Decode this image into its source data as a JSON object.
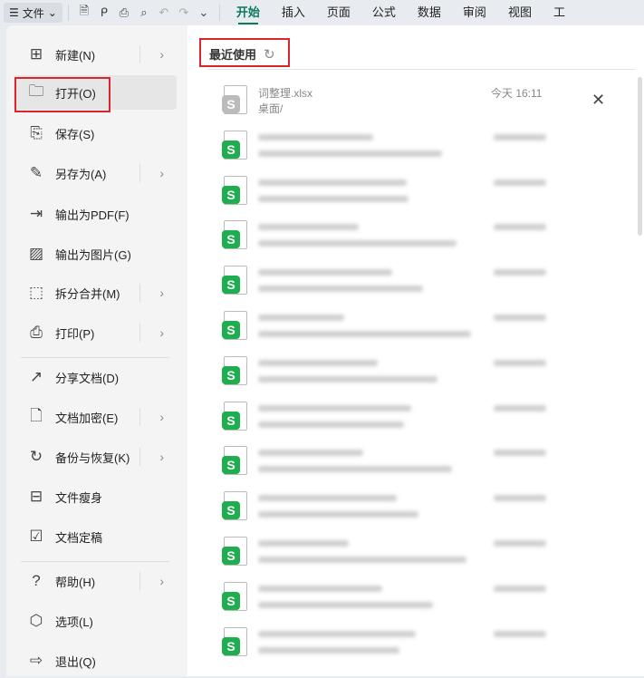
{
  "toolbar": {
    "file_label": "文件",
    "tabs": [
      "开始",
      "插入",
      "页面",
      "公式",
      "数据",
      "审阅",
      "视图",
      "工"
    ]
  },
  "menu": {
    "items": [
      {
        "label": "新建(N)",
        "icon": "new-file-icon",
        "glyph": "⊞",
        "sub": true
      },
      {
        "label": "打开(O)",
        "icon": "folder-open-icon",
        "glyph": "🗀",
        "sub": false
      },
      {
        "label": "保存(S)",
        "icon": "save-icon",
        "glyph": "⎘",
        "sub": false
      },
      {
        "label": "另存为(A)",
        "icon": "save-as-icon",
        "glyph": "✎",
        "sub": true
      },
      {
        "label": "输出为PDF(F)",
        "icon": "export-pdf-icon",
        "glyph": "⇥",
        "sub": false
      },
      {
        "label": "输出为图片(G)",
        "icon": "export-image-icon",
        "glyph": "▨",
        "sub": false
      },
      {
        "label": "拆分合并(M)",
        "icon": "split-merge-icon",
        "glyph": "⬚",
        "sub": true
      },
      {
        "label": "打印(P)",
        "icon": "print-icon",
        "glyph": "⎙",
        "sub": true
      },
      {
        "label": "分享文档(D)",
        "icon": "share-icon",
        "glyph": "↗",
        "sub": false
      },
      {
        "label": "文档加密(E)",
        "icon": "encrypt-icon",
        "glyph": "🗋",
        "sub": true
      },
      {
        "label": "备份与恢复(K)",
        "icon": "backup-icon",
        "glyph": "↻",
        "sub": true
      },
      {
        "label": "文件瘦身",
        "icon": "compress-icon",
        "glyph": "⊟",
        "sub": false
      },
      {
        "label": "文档定稿",
        "icon": "finalize-icon",
        "glyph": "☑",
        "sub": false
      },
      {
        "label": "帮助(H)",
        "icon": "help-icon",
        "glyph": "?",
        "sub": true
      },
      {
        "label": "选项(L)",
        "icon": "options-icon",
        "glyph": "⬡",
        "sub": false
      },
      {
        "label": "退出(Q)",
        "icon": "exit-icon",
        "glyph": "⇨",
        "sub": false
      }
    ]
  },
  "recent": {
    "title": "最近使用",
    "first_file": {
      "name": "词整理.xlsx",
      "path": "桌面/",
      "time": "今天 16:11"
    }
  },
  "colors": {
    "accent": "#0a7a5a",
    "highlight": "#d9262e",
    "sheet_green": "#1fae4f"
  }
}
